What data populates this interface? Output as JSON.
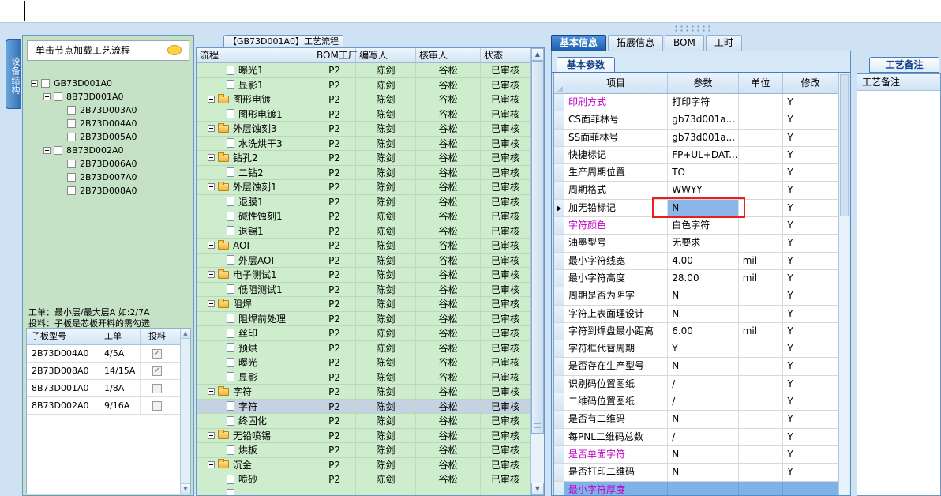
{
  "side_tab": {
    "label": "设备结构"
  },
  "left_panel": {
    "hint": "单击节点加载工艺流程",
    "tree": [
      {
        "label": "GB73D001A0",
        "level": 0,
        "expander": true
      },
      {
        "label": "8B73D001A0",
        "level": 1,
        "expander": true
      },
      {
        "label": "2B73D003A0",
        "level": 2,
        "expander": false
      },
      {
        "label": "2B73D004A0",
        "level": 2,
        "expander": false
      },
      {
        "label": "2B73D005A0",
        "level": 2,
        "expander": false
      },
      {
        "label": "8B73D002A0",
        "level": 1,
        "expander": true
      },
      {
        "label": "2B73D006A0",
        "level": 2,
        "expander": false
      },
      {
        "label": "2B73D007A0",
        "level": 2,
        "expander": false
      },
      {
        "label": "2B73D008A0",
        "level": 2,
        "expander": false
      }
    ],
    "notes": [
      "工单：最小层/最大层A 如:2/7A",
      "投料：子板是芯板开料的需勾选"
    ],
    "table": {
      "headers": [
        "子板型号",
        "工单",
        "投料"
      ],
      "rows": [
        {
          "model": "2B73D004A0",
          "order": "4/5A",
          "checked": true
        },
        {
          "model": "2B73D008A0",
          "order": "14/15A",
          "checked": true
        },
        {
          "model": "8B73D001A0",
          "order": "1/8A",
          "checked": false
        },
        {
          "model": "8B73D002A0",
          "order": "9/16A",
          "checked": false
        }
      ]
    }
  },
  "flow_panel": {
    "tab_title": "【GB73D001A0】工艺流程",
    "headers": [
      "流程",
      "BOM工厂",
      "编写人",
      "核审人",
      "状态"
    ],
    "rows": [
      {
        "name": "曝光1",
        "kind": "doc",
        "factory": "P2",
        "writer": "陈剑",
        "reviewer": "谷松",
        "status": "已审核"
      },
      {
        "name": "显影1",
        "kind": "doc",
        "factory": "P2",
        "writer": "陈剑",
        "reviewer": "谷松",
        "status": "已审核"
      },
      {
        "name": "图形电镀",
        "kind": "folder",
        "factory": "P2",
        "writer": "陈剑",
        "reviewer": "谷松",
        "status": "已审核"
      },
      {
        "name": "图形电镀1",
        "kind": "doc",
        "factory": "P2",
        "writer": "陈剑",
        "reviewer": "谷松",
        "status": "已审核"
      },
      {
        "name": "外层蚀刻3",
        "kind": "folder",
        "factory": "P2",
        "writer": "陈剑",
        "reviewer": "谷松",
        "status": "已审核"
      },
      {
        "name": "水洗烘干3",
        "kind": "doc",
        "factory": "P2",
        "writer": "陈剑",
        "reviewer": "谷松",
        "status": "已审核"
      },
      {
        "name": "钻孔2",
        "kind": "folder",
        "factory": "P2",
        "writer": "陈剑",
        "reviewer": "谷松",
        "status": "已审核"
      },
      {
        "name": "二钻2",
        "kind": "doc",
        "factory": "P2",
        "writer": "陈剑",
        "reviewer": "谷松",
        "status": "已审核"
      },
      {
        "name": "外层蚀刻1",
        "kind": "folder",
        "factory": "P2",
        "writer": "陈剑",
        "reviewer": "谷松",
        "status": "已审核"
      },
      {
        "name": "退膜1",
        "kind": "doc",
        "factory": "P2",
        "writer": "陈剑",
        "reviewer": "谷松",
        "status": "已审核"
      },
      {
        "name": "碱性蚀刻1",
        "kind": "doc",
        "factory": "P2",
        "writer": "陈剑",
        "reviewer": "谷松",
        "status": "已审核"
      },
      {
        "name": "退锡1",
        "kind": "doc",
        "factory": "P2",
        "writer": "陈剑",
        "reviewer": "谷松",
        "status": "已审核"
      },
      {
        "name": "AOI",
        "kind": "folder",
        "factory": "P2",
        "writer": "陈剑",
        "reviewer": "谷松",
        "status": "已审核"
      },
      {
        "name": "外层AOI",
        "kind": "doc",
        "factory": "P2",
        "writer": "陈剑",
        "reviewer": "谷松",
        "status": "已审核"
      },
      {
        "name": "电子测试1",
        "kind": "folder",
        "factory": "P2",
        "writer": "陈剑",
        "reviewer": "谷松",
        "status": "已审核"
      },
      {
        "name": "低阻测试1",
        "kind": "doc",
        "factory": "P2",
        "writer": "陈剑",
        "reviewer": "谷松",
        "status": "已审核"
      },
      {
        "name": "阻焊",
        "kind": "folder",
        "factory": "P2",
        "writer": "陈剑",
        "reviewer": "谷松",
        "status": "已审核"
      },
      {
        "name": "阻焊前处理",
        "kind": "doc",
        "factory": "P2",
        "writer": "陈剑",
        "reviewer": "谷松",
        "status": "已审核"
      },
      {
        "name": "丝印",
        "kind": "doc",
        "factory": "P2",
        "writer": "陈剑",
        "reviewer": "谷松",
        "status": "已审核"
      },
      {
        "name": "预烘",
        "kind": "doc",
        "factory": "P2",
        "writer": "陈剑",
        "reviewer": "谷松",
        "status": "已审核"
      },
      {
        "name": "曝光",
        "kind": "doc",
        "factory": "P2",
        "writer": "陈剑",
        "reviewer": "谷松",
        "status": "已审核"
      },
      {
        "name": "显影",
        "kind": "doc",
        "factory": "P2",
        "writer": "陈剑",
        "reviewer": "谷松",
        "status": "已审核"
      },
      {
        "name": "字符",
        "kind": "folder",
        "factory": "P2",
        "writer": "陈剑",
        "reviewer": "谷松",
        "status": "已审核"
      },
      {
        "name": "字符",
        "kind": "doc",
        "selected": true,
        "factory": "P2",
        "writer": "陈剑",
        "reviewer": "谷松",
        "status": "已审核"
      },
      {
        "name": "终固化",
        "kind": "doc",
        "factory": "P2",
        "writer": "陈剑",
        "reviewer": "谷松",
        "status": "已审核"
      },
      {
        "name": "无铅喷锡",
        "kind": "folder",
        "factory": "P2",
        "writer": "陈剑",
        "reviewer": "谷松",
        "status": "已审核"
      },
      {
        "name": "烘板",
        "kind": "doc",
        "factory": "P2",
        "writer": "陈剑",
        "reviewer": "谷松",
        "status": "已审核"
      },
      {
        "name": "沉金",
        "kind": "folder",
        "factory": "P2",
        "writer": "陈剑",
        "reviewer": "谷松",
        "status": "已审核"
      },
      {
        "name": "喷砂",
        "kind": "doc",
        "factory": "P2",
        "writer": "陈剑",
        "reviewer": "谷松",
        "status": "已审核"
      },
      {
        "name": "",
        "kind": "doc",
        "factory": "",
        "writer": "",
        "reviewer": "",
        "status": ""
      }
    ]
  },
  "right_panel": {
    "tabs": [
      "基本信息",
      "拓展信息",
      "BOM",
      "工时"
    ],
    "active_tab": "基本信息",
    "sub_tab": "基本参数",
    "headers": [
      "项目",
      "参数",
      "单位",
      "修改"
    ],
    "rows": [
      {
        "item": "印刷方式",
        "value": "打印字符",
        "unit": "",
        "modify": "Y",
        "magenta": true
      },
      {
        "item": "CS面菲林号",
        "value": "gb73d001a...",
        "unit": "",
        "modify": "Y"
      },
      {
        "item": "SS面菲林号",
        "value": "gb73d001a...",
        "unit": "",
        "modify": "Y"
      },
      {
        "item": "快捷标记",
        "value": "FP+UL+DAT...",
        "unit": "",
        "modify": "Y"
      },
      {
        "item": "生产周期位置",
        "value": "TO",
        "unit": "",
        "modify": "Y"
      },
      {
        "item": "周期格式",
        "value": "WWYY",
        "unit": "",
        "modify": "Y"
      },
      {
        "item": "加无铅标记",
        "value": "N",
        "unit": "",
        "modify": "Y",
        "active": true,
        "highlight": true
      },
      {
        "item": "字符颜色",
        "value": "白色字符",
        "unit": "",
        "modify": "Y",
        "magenta": true
      },
      {
        "item": "油墨型号",
        "value": "无要求",
        "unit": "",
        "modify": "Y"
      },
      {
        "item": "最小字符线宽",
        "value": "4.00",
        "unit": "mil",
        "modify": "Y"
      },
      {
        "item": "最小字符高度",
        "value": "28.00",
        "unit": "mil",
        "modify": "Y"
      },
      {
        "item": "周期是否为阴字",
        "value": "N",
        "unit": "",
        "modify": "Y"
      },
      {
        "item": "字符上表面理设计",
        "value": "N",
        "unit": "",
        "modify": "Y"
      },
      {
        "item": "字符到焊盘最小距离",
        "value": "6.00",
        "unit": "mil",
        "modify": "Y"
      },
      {
        "item": "字符框代替周期",
        "value": "Y",
        "unit": "",
        "modify": "Y"
      },
      {
        "item": "是否存在生产型号",
        "value": "N",
        "unit": "",
        "modify": "Y"
      },
      {
        "item": "识别码位置图纸",
        "value": "/",
        "unit": "",
        "modify": "Y"
      },
      {
        "item": "二维码位置图纸",
        "value": "/",
        "unit": "",
        "modify": "Y"
      },
      {
        "item": "是否有二维码",
        "value": "N",
        "unit": "",
        "modify": "Y"
      },
      {
        "item": "每PNL二维码总数",
        "value": "/",
        "unit": "",
        "modify": "Y"
      },
      {
        "item": "是否单面字符",
        "value": "N",
        "unit": "",
        "modify": "Y",
        "magenta": true
      },
      {
        "item": "是否打印二维码",
        "value": "N",
        "unit": "",
        "modify": "Y"
      },
      {
        "item": "最小字符厚度",
        "value": "",
        "unit": "",
        "modify": "",
        "magenta": true,
        "partial": true
      }
    ]
  },
  "remark": {
    "tab": "工艺备注",
    "header": "工艺备注"
  },
  "colors": {
    "accent_blue": "#1a5fae",
    "magenta_label": "#c400c4",
    "highlight_cell_bg": "#8ab6ea",
    "red_box": "#e62020",
    "grid_green": "#cdedcd",
    "panel_green": "#c6e2c6"
  }
}
